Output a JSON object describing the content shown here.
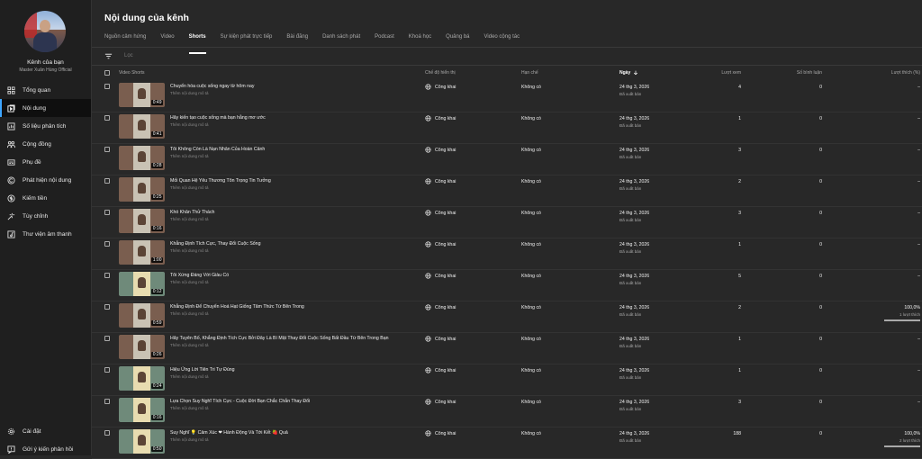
{
  "channel": {
    "name": "Kênh của bạn",
    "subtitle": "Master Xuân Hùng Official"
  },
  "nav": [
    {
      "label": "Tổng quan",
      "icon": "dashboard-icon"
    },
    {
      "label": "Nội dung",
      "icon": "content-icon",
      "active": true
    },
    {
      "label": "Số liệu phân tích",
      "icon": "analytics-icon"
    },
    {
      "label": "Cộng đồng",
      "icon": "community-icon"
    },
    {
      "label": "Phụ đề",
      "icon": "subtitles-icon"
    },
    {
      "label": "Phát hiện nội dung",
      "icon": "copyright-icon"
    },
    {
      "label": "Kiếm tiền",
      "icon": "monetization-icon"
    },
    {
      "label": "Tùy chỉnh",
      "icon": "customization-icon"
    },
    {
      "label": "Thư viện âm thanh",
      "icon": "audio-library-icon"
    }
  ],
  "nav_bottom": [
    {
      "label": "Cài đặt",
      "icon": "settings-icon"
    },
    {
      "label": "Gửi ý kiến phản hồi",
      "icon": "feedback-icon"
    }
  ],
  "page": {
    "title": "Nội dung của kênh",
    "filter_placeholder": "Lọc"
  },
  "tabs": [
    "Nguồn cảm hứng",
    "Video",
    "Shorts",
    "Sự kiện phát trực tiếp",
    "Bài đăng",
    "Danh sách phát",
    "Podcast",
    "Khoá học",
    "Quảng bá",
    "Video cộng tác"
  ],
  "active_tab": 2,
  "columns": {
    "video": "Video Shorts",
    "visibility": "Chế độ hiển thị",
    "restrictions": "Hạn chế",
    "date": "Ngày",
    "views": "Lượt xem",
    "comments": "Số bình luận",
    "likes": "Lượt thích (%)"
  },
  "rows": [
    {
      "title": "Chuyển hóa cuộc sống ngay từ hôm nay",
      "desc": "Thêm nội dung mô tả",
      "duration": "0:49",
      "thumb": "a",
      "visibility": "Công khai",
      "restrictions": "Không có",
      "date": "24 thg 3, 2026",
      "status": "Đã xuất bản",
      "views": "4",
      "comments": "0",
      "likes": "–",
      "likes_sub": ""
    },
    {
      "title": "Hãy kiến tạo cuộc sống mà bạn hằng mơ ước",
      "desc": "Thêm nội dung mô tả",
      "duration": "0:41",
      "thumb": "a",
      "visibility": "Công khai",
      "restrictions": "Không có",
      "date": "24 thg 3, 2026",
      "status": "Đã xuất bản",
      "views": "1",
      "comments": "0",
      "likes": "–",
      "likes_sub": ""
    },
    {
      "title": "Tôi Không Còn Là Nạn Nhân Của Hoàn Cảnh",
      "desc": "Thêm nội dung mô tả",
      "duration": "0:28",
      "thumb": "a",
      "visibility": "Công khai",
      "restrictions": "Không có",
      "date": "24 thg 3, 2026",
      "status": "Đã xuất bản",
      "views": "3",
      "comments": "0",
      "likes": "–",
      "likes_sub": ""
    },
    {
      "title": "Mối Quan Hệ Yêu Thương Tôn Trọng Tin Tưởng",
      "desc": "Thêm nội dung mô tả",
      "duration": "0:25",
      "thumb": "a",
      "visibility": "Công khai",
      "restrictions": "Không có",
      "date": "24 thg 3, 2026",
      "status": "Đã xuất bản",
      "views": "2",
      "comments": "0",
      "likes": "–",
      "likes_sub": ""
    },
    {
      "title": "Khó Khăn Thử Thách",
      "desc": "Thêm nội dung mô tả",
      "duration": "0:16",
      "thumb": "a",
      "visibility": "Công khai",
      "restrictions": "Không có",
      "date": "24 thg 3, 2026",
      "status": "Đã xuất bản",
      "views": "3",
      "comments": "0",
      "likes": "–",
      "likes_sub": ""
    },
    {
      "title": "Khẳng Định Tích Cực, Thay Đổi Cuộc Sống",
      "desc": "Thêm nội dung mô tả",
      "duration": "1:00",
      "thumb": "a",
      "visibility": "Công khai",
      "restrictions": "Không có",
      "date": "24 thg 3, 2026",
      "status": "Đã xuất bản",
      "views": "1",
      "comments": "0",
      "likes": "–",
      "likes_sub": ""
    },
    {
      "title": "Tôi Xứng Đáng Với Giàu Có",
      "desc": "Thêm nội dung mô tả",
      "duration": "0:12",
      "thumb": "b",
      "visibility": "Công khai",
      "restrictions": "Không có",
      "date": "24 thg 3, 2026",
      "status": "Đã xuất bản",
      "views": "5",
      "comments": "0",
      "likes": "–",
      "likes_sub": ""
    },
    {
      "title": "Khẳng Định Để Chuyển Hoá Hạt Giống Tâm Thức Từ Bên Trong",
      "desc": "Thêm nội dung mô tả",
      "duration": "0:59",
      "thumb": "a",
      "visibility": "Công khai",
      "restrictions": "Không có",
      "date": "24 thg 3, 2026",
      "status": "Đã xuất bản",
      "views": "2",
      "comments": "0",
      "likes": "100,0%",
      "likes_sub": "1 lượt thích"
    },
    {
      "title": "Hãy Tuyên Bố, Khẳng Định Tích Cực Bởi Đây Là Bí Mật Thay Đổi Cuộc Sống Bất Đầu Từ Bên Trong Bạn",
      "desc": "Thêm nội dung mô tả",
      "duration": "0:26",
      "thumb": "a",
      "visibility": "Công khai",
      "restrictions": "Không có",
      "date": "24 thg 3, 2026",
      "status": "Đã xuất bản",
      "views": "1",
      "comments": "0",
      "likes": "–",
      "likes_sub": ""
    },
    {
      "title": "Hiệu Ứng Lời Tiên Tri Tự Đúng",
      "desc": "Thêm nội dung mô tả",
      "duration": "0:24",
      "thumb": "b",
      "visibility": "Công khai",
      "restrictions": "Không có",
      "date": "24 thg 3, 2026",
      "status": "Đã xuất bản",
      "views": "1",
      "comments": "0",
      "likes": "–",
      "likes_sub": ""
    },
    {
      "title": "Lựa Chọn Suy Nghĩ Tích Cực - Cuộc Đời Bạn Chắc Chắn Thay Đổi",
      "desc": "Thêm nội dung mô tả",
      "duration": "0:16",
      "thumb": "b",
      "visibility": "Công khai",
      "restrictions": "Không có",
      "date": "24 thg 3, 2026",
      "status": "Đã xuất bản",
      "views": "3",
      "comments": "0",
      "likes": "–",
      "likes_sub": ""
    },
    {
      "title": "Suy Nghĩ 💡 Cảm Xúc ❤ Hành Động Và Tới Kết 🍓 Quả",
      "desc": "Thêm nội dung mô tả",
      "duration": "0:50",
      "thumb": "b",
      "visibility": "Công khai",
      "restrictions": "Không có",
      "date": "24 thg 3, 2026",
      "status": "Đã xuất bản",
      "views": "188",
      "comments": "0",
      "likes": "100,0%",
      "likes_sub": "2 lượt thích"
    }
  ]
}
